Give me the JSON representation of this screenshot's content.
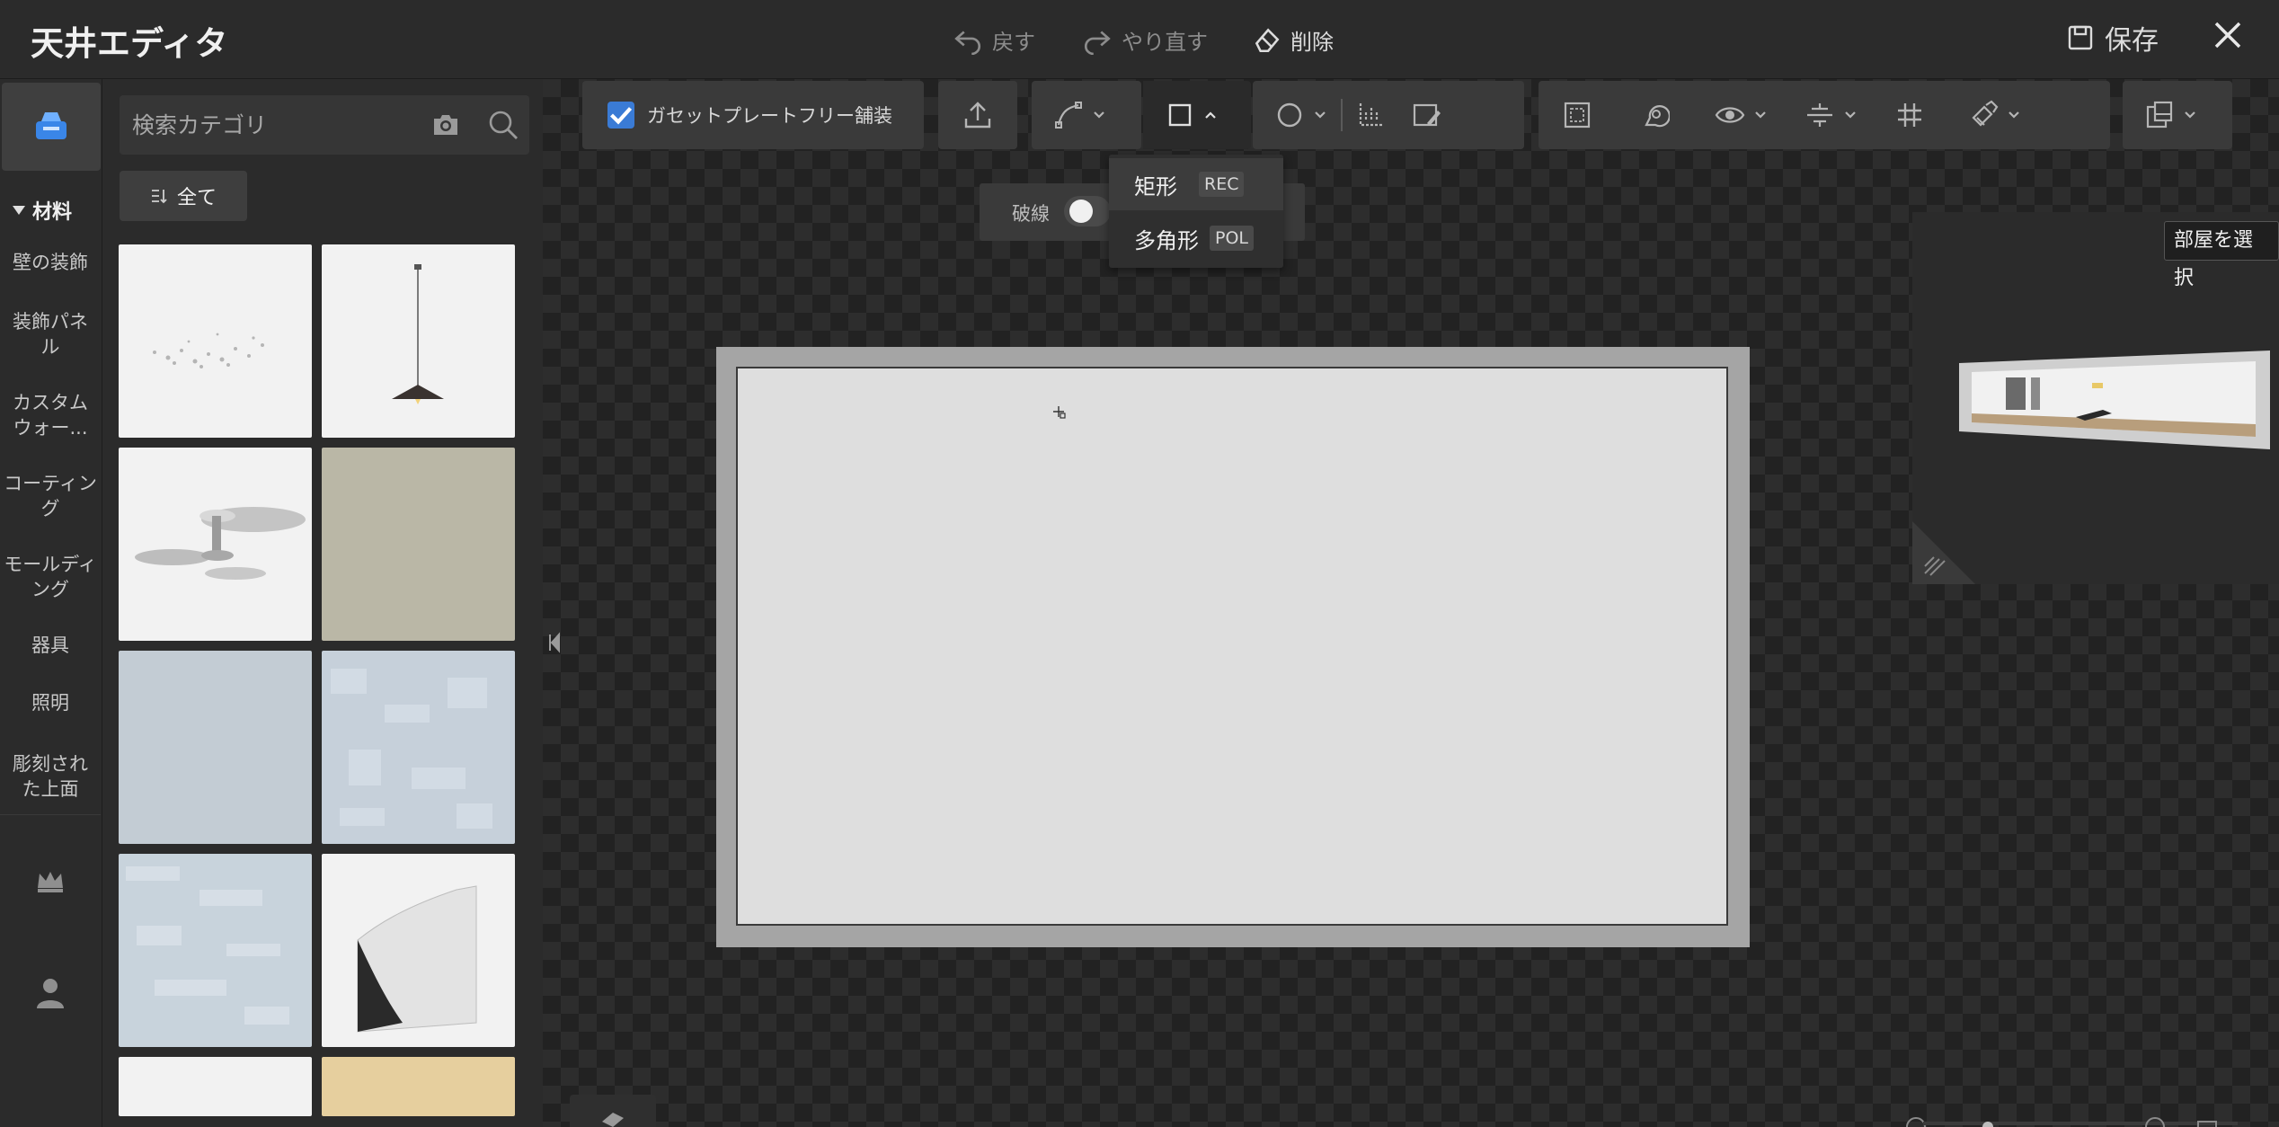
{
  "header": {
    "title": "天井エディタ",
    "undo_label": "戻す",
    "redo_label": "やり直す",
    "delete_label": "削除",
    "save_label": "保存"
  },
  "sidebar": {
    "heading": "材料",
    "items": [
      {
        "label": "壁の装飾"
      },
      {
        "label": "装飾パネル"
      },
      {
        "label": "カスタムウォー..."
      },
      {
        "label": "コーティング"
      },
      {
        "label": "モールディング"
      },
      {
        "label": "器具"
      },
      {
        "label": "照明"
      },
      {
        "label": "彫刻された上面"
      }
    ]
  },
  "panel": {
    "search_placeholder": "検索カテゴリ",
    "filter_label": "全て"
  },
  "toolbar": {
    "checkbox_label": "ガセットプレートフリー舗装",
    "checkbox_checked": true
  },
  "subbar": {
    "dash_label": "破線"
  },
  "shape_menu": {
    "items": [
      {
        "label": "矩形",
        "tag": "REC"
      },
      {
        "label": "多角形",
        "tag": "POL"
      }
    ]
  },
  "preview": {
    "select_room_label": "部屋を選択"
  },
  "colors": {
    "accent": "#3a7bd5",
    "background": "#242424",
    "panel": "#2b2b2b",
    "room_fill": "#dedede",
    "room_border": "#a5a5a5"
  }
}
